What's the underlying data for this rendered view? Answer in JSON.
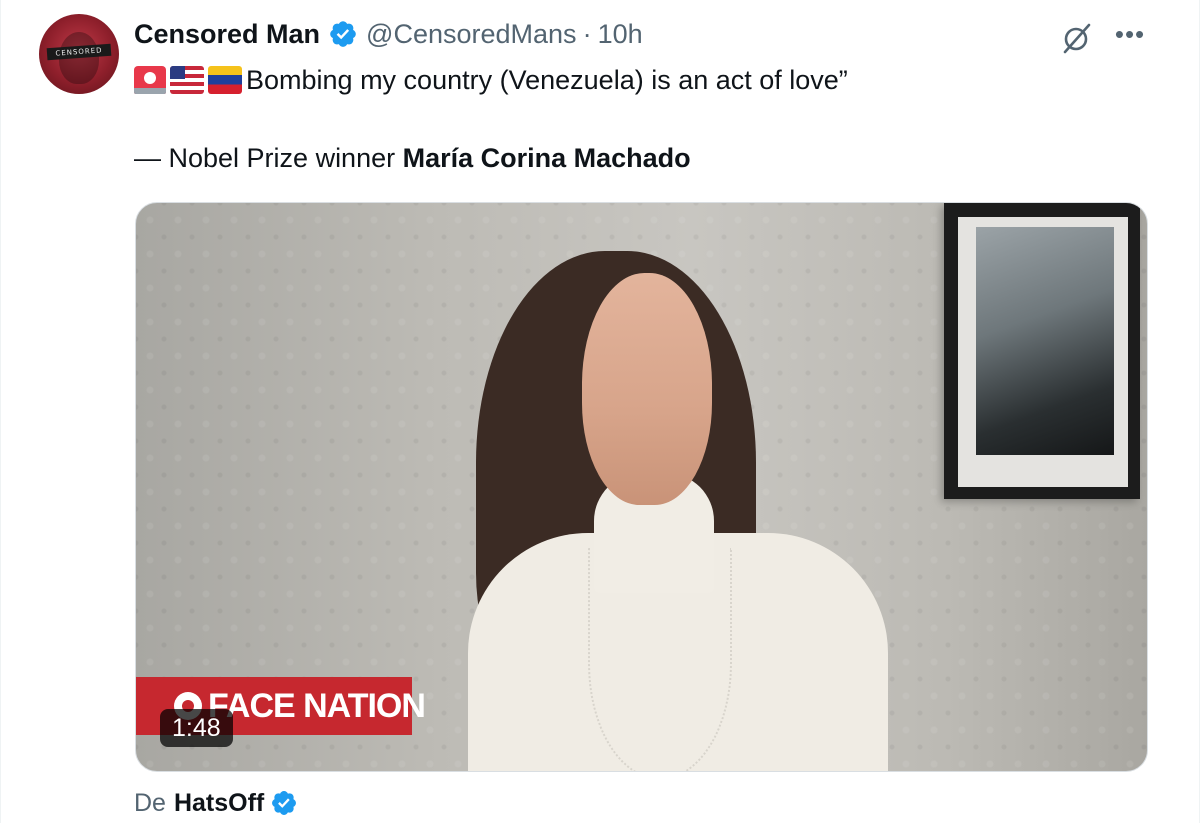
{
  "post": {
    "author_name": "Censored Man",
    "author_handle": "@CensoredMans",
    "separator": "·",
    "time": "10h",
    "avatar_text": "CENSORED",
    "text_line1": "Bombing my country (Venezuela) is an act of love”",
    "text_line2_prefix": "— Nobel Prize winner ",
    "text_line2_bold": "María Corina Machado",
    "emojis": [
      "police-siren",
      "flag-us",
      "flag-venezuela"
    ]
  },
  "media": {
    "type": "video",
    "duration": "1:48",
    "overlay_logo_text": "FACE NATION"
  },
  "footer": {
    "prefix": "De",
    "source_name": "HatsOff"
  },
  "icons": {
    "verified": "verified-badge-icon",
    "grok": "grok-icon",
    "more": "more-icon"
  },
  "colors": {
    "verified": "#1d9bf0",
    "secondary_text": "#536471",
    "logo_red": "#c6282f"
  }
}
